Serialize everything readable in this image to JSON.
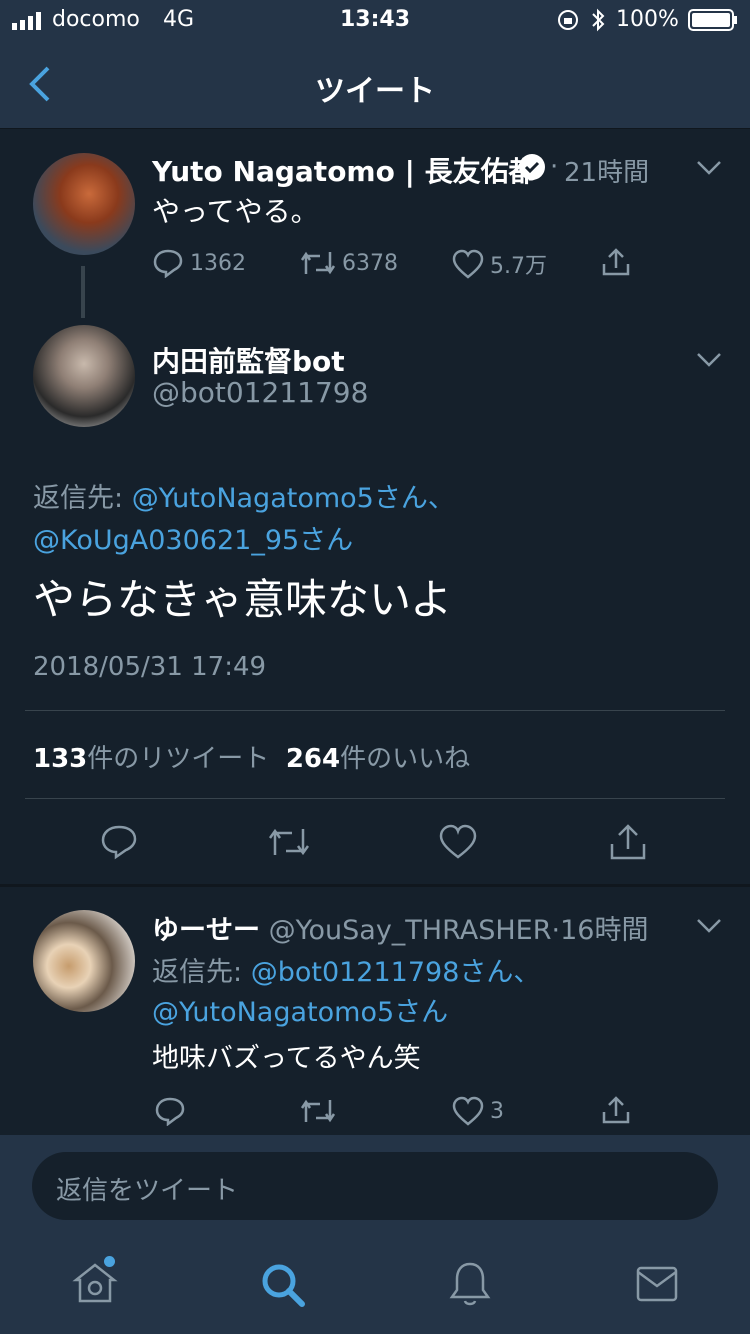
{
  "status_bar": {
    "carrier": "docomo",
    "network": "4G",
    "time": "13:43",
    "battery": "100%"
  },
  "nav": {
    "title": "ツイート",
    "back_icon": "chevron-left-icon"
  },
  "parent_tweet": {
    "name": "Yuto Nagatomo | 長友佑都",
    "verified": true,
    "time": "21時間",
    "text": "やってやる。",
    "replies": "1362",
    "retweets": "6378",
    "likes": "5.7万"
  },
  "main_tweet": {
    "name": "内田前監督bot",
    "handle": "@bot01211798",
    "reply_label": "返信先:",
    "reply_to_1": "@YutoNagatomo5さん、",
    "reply_to_2": "@KoUgA030621_95さん",
    "text": "やらなきゃ意味ないよ",
    "timestamp": "2018/05/31 17:49",
    "retweet_count": "133",
    "retweet_label": "件のリツイート",
    "like_count": "264",
    "like_label": "件のいいね"
  },
  "reply_tweet": {
    "name": "ゆーせー",
    "handle": "@YouSay_THRASHER",
    "time": "16時間",
    "reply_label": "返信先:",
    "reply_to_1": "@bot01211798さん、",
    "reply_to_2": "@YutoNagatomo5さん",
    "text": "地味バズってるやん笑",
    "likes": "3"
  },
  "reply_input": {
    "placeholder": "返信をツイート"
  },
  "colors": {
    "background": "#15202b",
    "bar": "#243447",
    "accent": "#4aa3df",
    "muted": "#8899a6"
  }
}
